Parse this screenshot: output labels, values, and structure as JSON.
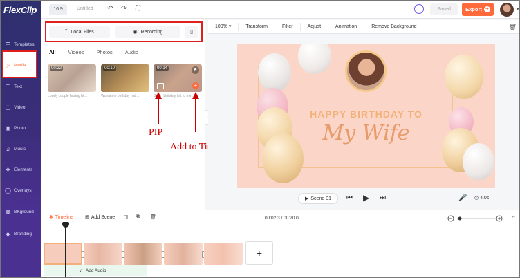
{
  "app": {
    "logo": "FlexClip",
    "title": "Untitled",
    "aspect_ratio": "16:9"
  },
  "topbar": {
    "saved_label": "Saved",
    "export_label": "Export"
  },
  "sidebar": {
    "items": [
      {
        "label": "Templates",
        "icon": "layers-icon"
      },
      {
        "label": "Media",
        "icon": "folder-icon"
      },
      {
        "label": "Text",
        "icon": "text-icon"
      },
      {
        "label": "Video",
        "icon": "video-icon"
      },
      {
        "label": "Photo",
        "icon": "image-icon"
      },
      {
        "label": "Music",
        "icon": "music-icon"
      },
      {
        "label": "Elements",
        "icon": "elements-icon"
      },
      {
        "label": "Overlays",
        "icon": "overlays-icon"
      },
      {
        "label": "BKground",
        "icon": "background-icon"
      },
      {
        "label": "Branding",
        "icon": "branding-icon"
      }
    ]
  },
  "media_panel": {
    "local_files_label": "Local Files",
    "recording_label": "Recording",
    "tabs": [
      "All",
      "Videos",
      "Photos",
      "Audio"
    ],
    "thumbnails": [
      {
        "duration": "00:22",
        "caption": "Lovely couple having bir..."
      },
      {
        "duration": "00:10",
        "caption": "Woman in birthday hat ..."
      },
      {
        "duration": "00:14",
        "caption": "Girl in birthday hat to me..."
      }
    ]
  },
  "annotations": {
    "pip": "PIP",
    "add_to_timeline": "Add to Timeline"
  },
  "editor_toolbar": {
    "zoom": "100%",
    "items": [
      "Transform",
      "Filter",
      "Adjust",
      "Animation",
      "Remove Background"
    ]
  },
  "canvas": {
    "line1": "HAPPY BIRTHDAY TO",
    "line2": "My Wife"
  },
  "scene_bar": {
    "scene_label": "Scene 01",
    "duration": "4.0s"
  },
  "timeline": {
    "timeline_label": "Timeline",
    "add_scene_label": "Add Scene",
    "time_display": "00:02.3 / 00:20.0",
    "add_audio_label": "Add Audio",
    "clip_count": 5
  },
  "colors": {
    "accent": "#ff6a3d",
    "annotation": "#cc0000",
    "highlight_box": "#e01e1e"
  }
}
